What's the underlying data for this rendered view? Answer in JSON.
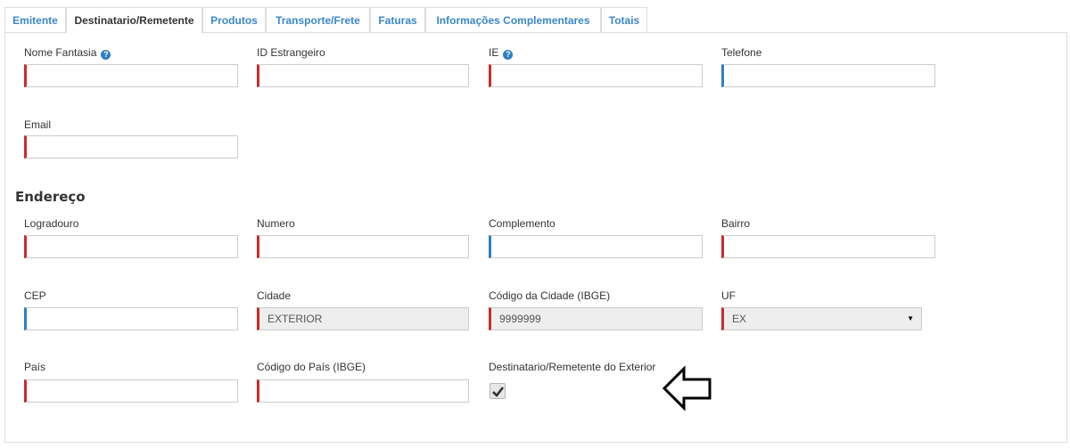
{
  "tabs": [
    {
      "label": "Emitente",
      "active": false
    },
    {
      "label": "Destinatario/Remetente",
      "active": true
    },
    {
      "label": "Produtos",
      "active": false
    },
    {
      "label": "Transporte/Frete",
      "active": false
    },
    {
      "label": "Faturas",
      "active": false
    },
    {
      "label": "Informações Complementares",
      "active": false
    },
    {
      "label": "Totais",
      "active": false
    }
  ],
  "form": {
    "nome_fantasia": {
      "label": "Nome Fantasia",
      "value": ""
    },
    "id_estrangeiro": {
      "label": "ID Estrangeiro",
      "value": ""
    },
    "ie": {
      "label": "IE",
      "value": ""
    },
    "telefone": {
      "label": "Telefone",
      "value": ""
    },
    "email": {
      "label": "Email",
      "value": ""
    }
  },
  "endereco": {
    "title": "Endereço",
    "logradouro": {
      "label": "Logradouro",
      "value": ""
    },
    "numero": {
      "label": "Numero",
      "value": ""
    },
    "complemento": {
      "label": "Complemento",
      "value": ""
    },
    "bairro": {
      "label": "Bairro",
      "value": ""
    },
    "cep": {
      "label": "CEP",
      "value": ""
    },
    "cidade": {
      "label": "Cidade",
      "value": "EXTERIOR"
    },
    "codigo_cidade": {
      "label": "Código da Cidade (IBGE)",
      "value": "9999999"
    },
    "uf": {
      "label": "UF",
      "value": "EX"
    },
    "pais": {
      "label": "País",
      "value": ""
    },
    "codigo_pais": {
      "label": "Código do País (IBGE)",
      "value": ""
    },
    "exterior": {
      "label": "Destinatario/Remetente do Exterior",
      "checked": true
    }
  },
  "icons": {
    "help": "question-circle-icon",
    "annotation": "left-arrow-icon",
    "check": "checkmark-icon"
  },
  "colors": {
    "tab_link": "#3a87c8",
    "required_border": "#cc2b2b",
    "optional_border": "#2f7fc1",
    "readonly_bg": "#eeeeee"
  }
}
